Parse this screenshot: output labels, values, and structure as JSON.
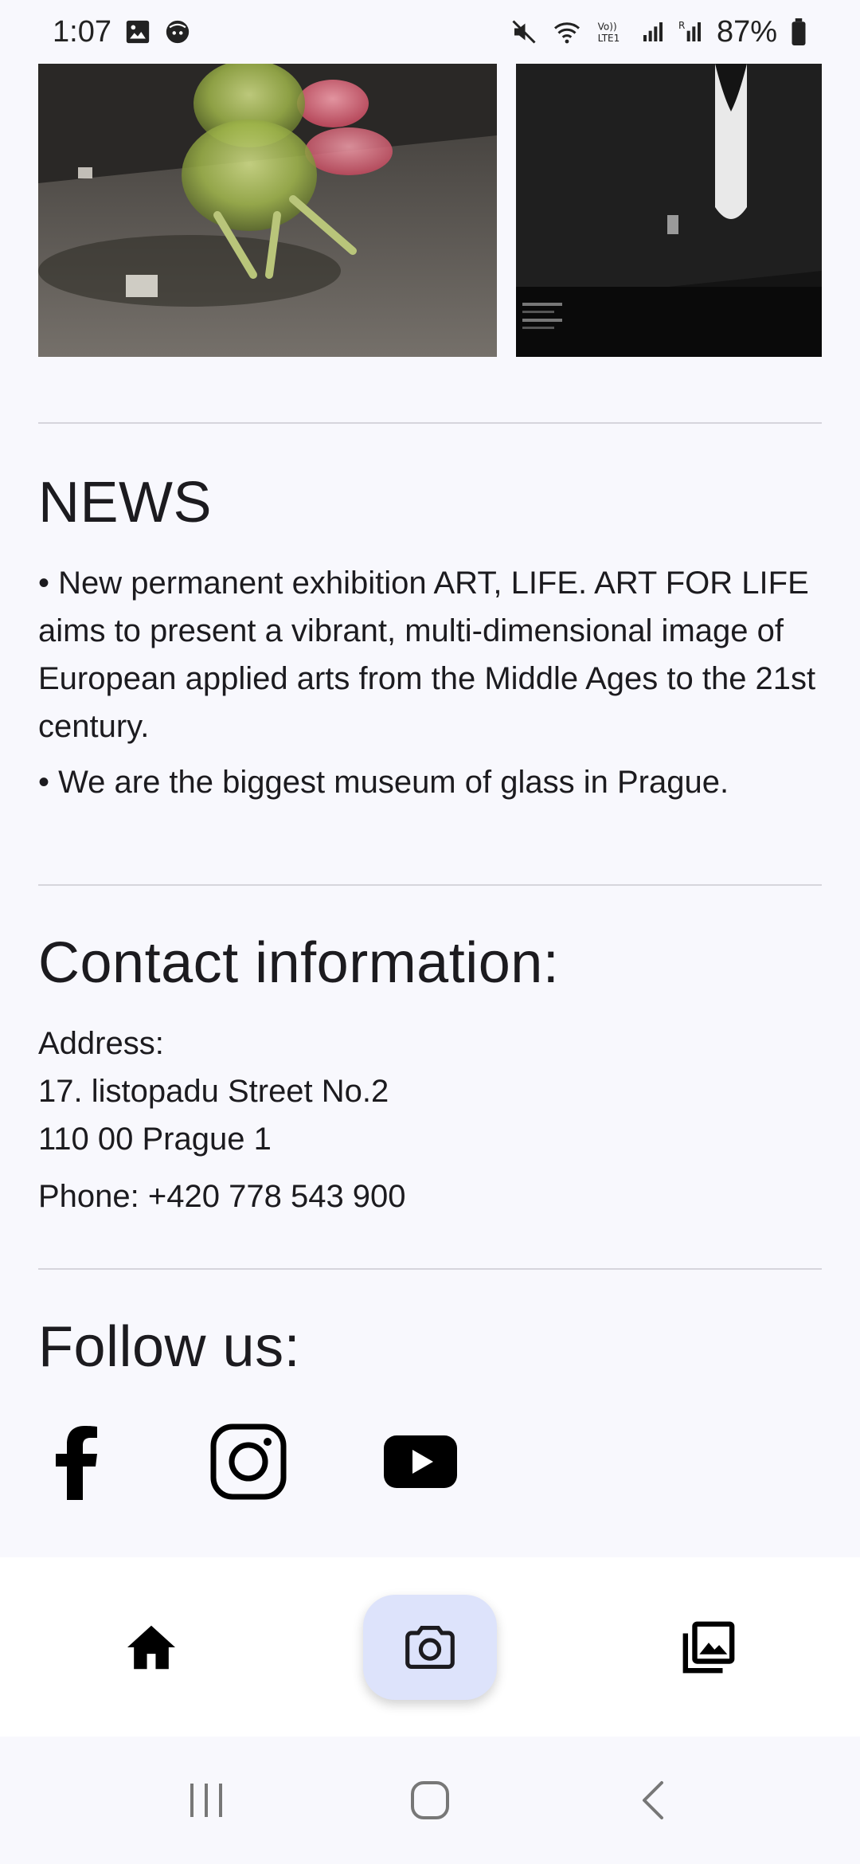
{
  "status_bar": {
    "time": "1:07",
    "battery": "87%",
    "icons": [
      "image-icon",
      "face-icon",
      "mute-icon",
      "wifi-icon",
      "volte-icon",
      "signal-icon",
      "signal-r-icon",
      "battery-icon"
    ]
  },
  "gallery": {
    "images": [
      {
        "name": "glass-sculpture-photo"
      },
      {
        "name": "white-vase-photo"
      }
    ]
  },
  "news": {
    "title": "NEWS",
    "items": [
      "• New permanent exhibition ART, LIFE. ART FOR LIFE aims to present a vibrant, multi-dimensional image of European applied arts from the Middle Ages to the 21st century.",
      "• We are the biggest museum of glass in Prague."
    ]
  },
  "contact": {
    "title": "Contact information:",
    "address_label": "Address:",
    "street": "17. listopadu Street No.2",
    "city": "110 00 Prague 1",
    "phone": "Phone: +420 778 543 900"
  },
  "follow": {
    "title": "Follow us:",
    "links": [
      "facebook-icon",
      "instagram-icon",
      "youtube-icon"
    ]
  },
  "bottom_nav": {
    "items": [
      "home-icon",
      "camera-icon",
      "gallery-icon"
    ],
    "active": "camera-icon",
    "active_color": "#dde3fb"
  },
  "system_nav": {
    "items": [
      "recents-icon",
      "home-button-icon",
      "back-icon"
    ]
  }
}
